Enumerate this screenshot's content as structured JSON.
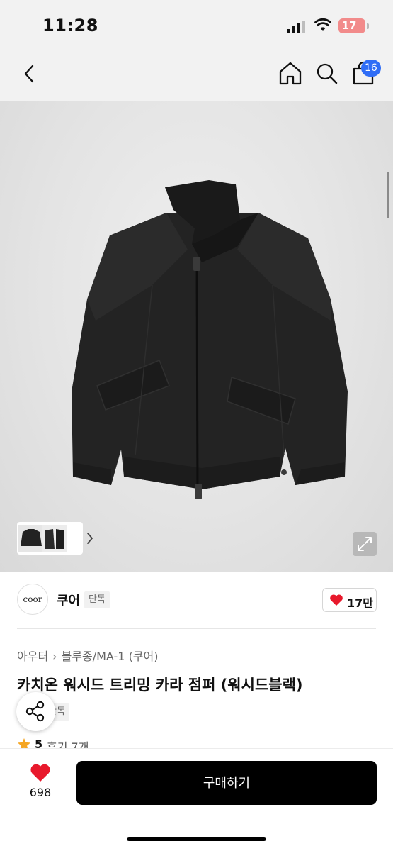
{
  "status_bar": {
    "time": "11:28",
    "battery": "17"
  },
  "nav": {
    "cart_count": "16"
  },
  "brand": {
    "logo_text": "coor",
    "name": "쿠어",
    "badge": "단독",
    "likes": "17만"
  },
  "colors": {
    "accent": "#2f6df6",
    "heart": "#e8192c",
    "star": "#f5a623",
    "buy_button": "#000000"
  },
  "product": {
    "breadcrumb": [
      "아우터",
      "블루종/MA-1 (쿠어)"
    ],
    "title": "카치온 워시드 트리밍 카라 점퍼 (워시드블랙)",
    "badge": "단독",
    "rating": "5",
    "reviews": "후기 7개"
  },
  "icons": {
    "back": "chevron-left-icon",
    "home": "home-icon",
    "search": "search-icon",
    "cart": "shopping-bag-icon",
    "expand": "expand-icon",
    "share": "share-icon",
    "like": "heart-icon",
    "star": "star-icon"
  },
  "bottom_bar": {
    "likes": "698",
    "buy_label": "구매하기"
  }
}
